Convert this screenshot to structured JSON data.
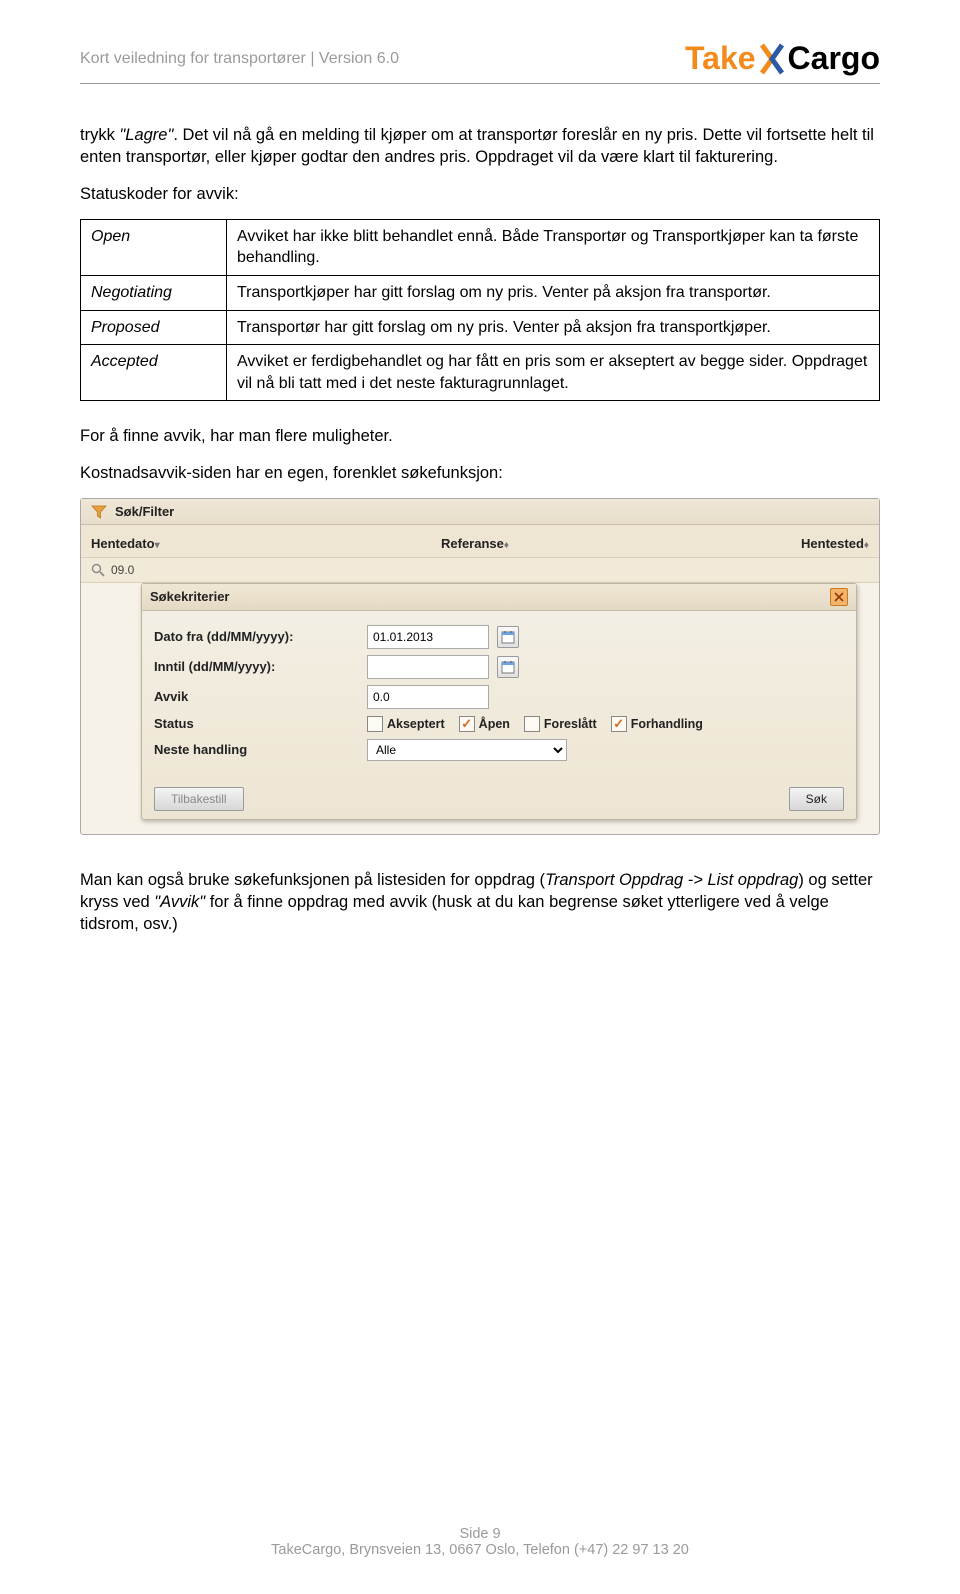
{
  "header": {
    "title": "Kort veiledning for transportører | Version 6.0"
  },
  "logo": {
    "take": "Take",
    "cargo": "Cargo"
  },
  "intro": {
    "p1_a": "trykk ",
    "p1_lagre": "\"Lagre\"",
    "p1_b": ". Det vil nå gå en melding til kjøper om at transportør foreslår en ny pris. Dette vil fortsette helt til enten transportør, eller kjøper godtar den andres pris. Oppdraget vil da være klart til fakturering.",
    "p2": "Statuskoder for avvik:"
  },
  "status_table": {
    "rows": [
      {
        "code": "Open",
        "desc": "Avviket har ikke blitt behandlet ennå. Både Transportør og Transportkjøper kan ta første behandling."
      },
      {
        "code": "Negotiating",
        "desc": "Transportkjøper har gitt forslag om ny pris. Venter på aksjon fra transportør."
      },
      {
        "code": "Proposed",
        "desc": "Transportør har gitt forslag om ny pris. Venter på aksjon fra transportkjøper."
      },
      {
        "code": "Accepted",
        "desc": "Avviket er ferdigbehandlet og har fått en pris som er akseptert av begge sider. Oppdraget vil nå bli tatt med i det neste fakturagrunnlaget."
      }
    ]
  },
  "mid": {
    "p1": "For å finne avvik, har man flere muligheter.",
    "p2": "Kostnadsavvik-siden har en egen, forenklet søkefunksjon:"
  },
  "panel": {
    "sokfilter": "Søk/Filter",
    "columns": {
      "hentedato": "Hentedato",
      "referanse": "Referanse",
      "hentested": "Hentested"
    },
    "daterow": "09.0",
    "dialog": {
      "title": "Søkekriterier",
      "datofra_label": "Dato fra (dd/MM/yyyy):",
      "datofra_val": "01.01.2013",
      "inntil_label": "Inntil (dd/MM/yyyy):",
      "inntil_val": "",
      "avvik_label": "Avvik",
      "avvik_val": "0.0",
      "status_label": "Status",
      "status_opts": {
        "akseptert": "Akseptert",
        "apen": "Åpen",
        "foreslatt": "Foreslått",
        "forhandling": "Forhandling"
      },
      "neste_label": "Neste handling",
      "neste_val": "Alle",
      "btn_reset": "Tilbakestill",
      "btn_sok": "Søk"
    }
  },
  "bottom": {
    "p_a": "Man kan også bruke søkefunksjonen på listesiden for oppdrag (",
    "p_nav": "Transport Oppdrag -> List oppdrag",
    "p_mid": ") og setter kryss ved ",
    "p_avvik": "\"Avvik\"",
    "p_b": " for å finne oppdrag med avvik (husk at du kan begrense søket ytterligere ved å velge tidsrom, osv.)"
  },
  "footer": {
    "side": "Side 9",
    "addr": "TakeCargo, Brynsveien 13, 0667 Oslo, Telefon (+47)  22 97 13 20"
  }
}
